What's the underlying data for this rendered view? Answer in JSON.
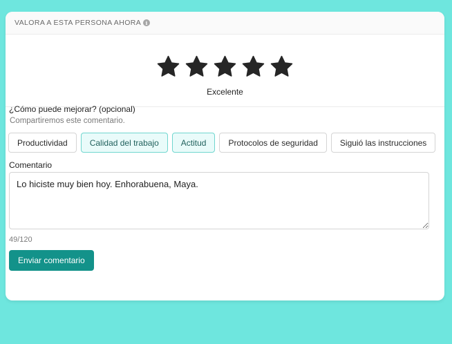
{
  "header": {
    "title": "VALORA A ESTA PERSONA AHORA",
    "info_icon": "info-icon"
  },
  "rating": {
    "max_stars": 5,
    "value": 5,
    "star_color": "#262626",
    "label": "Excelente"
  },
  "improve": {
    "title": "¿Cómo puede mejorar? (opcional)",
    "subtitle": "Compartiremos este comentario.",
    "chips": [
      {
        "label": "Productividad",
        "selected": false
      },
      {
        "label": "Calidad del trabajo",
        "selected": true
      },
      {
        "label": "Actitud",
        "selected": true
      },
      {
        "label": "Protocolos de seguridad",
        "selected": false
      },
      {
        "label": "Siguió las instrucciones",
        "selected": false
      }
    ]
  },
  "comment": {
    "label": "Comentario",
    "value": "Lo hiciste muy bien hoy. Enhorabuena, Maya.",
    "counter": "49/120"
  },
  "actions": {
    "submit_label": "Enviar comentario"
  },
  "colors": {
    "background": "#6ee6de",
    "accent": "#13928a",
    "chip_selected_bg": "#e9fbfa",
    "chip_selected_border": "#6fd6cf"
  }
}
